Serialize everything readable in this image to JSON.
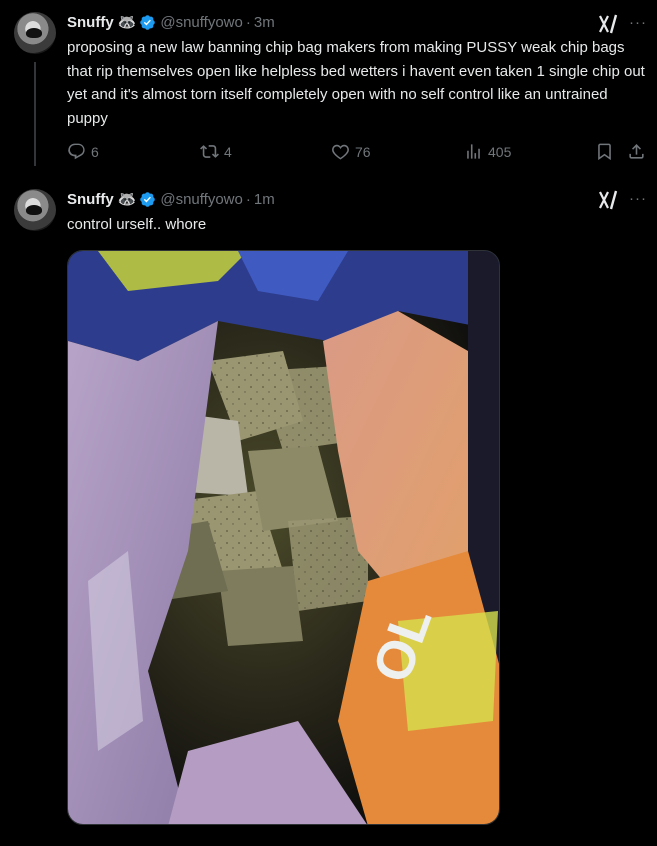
{
  "tweet1": {
    "display_name": "Snuffy",
    "emoji": "🦝",
    "handle": "@snuffyowo",
    "dot": "·",
    "time": "3m",
    "text": "proposing a new law banning chip bag makers from making PUSSY weak chip bags that rip themselves open like helpless bed wetters i havent even taken 1 single chip out yet and it's almost torn itself completely open with no self control like an untrained puppy",
    "replies": "6",
    "reposts": "4",
    "likes": "76",
    "views": "405"
  },
  "tweet2": {
    "display_name": "Snuffy",
    "emoji": "🦝",
    "handle": "@snuffyowo",
    "dot": "·",
    "time": "1m",
    "text": "control urself.. whore",
    "image_text": "OL"
  },
  "menu_glyph": "···",
  "colors": {
    "background": "#000000",
    "text": "#e7e9ea",
    "muted": "#71767b",
    "verified": "#1d9bf0"
  },
  "icons": [
    "reply-icon",
    "repost-icon",
    "like-icon",
    "views-icon",
    "bookmark-icon",
    "share-icon",
    "grok-icon",
    "more-icon",
    "verified-badge-icon"
  ]
}
